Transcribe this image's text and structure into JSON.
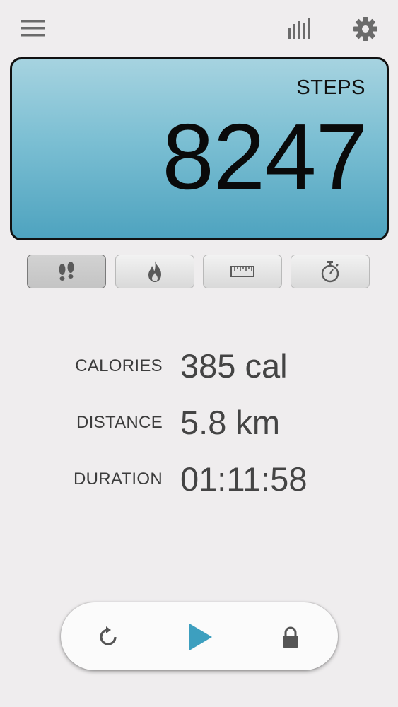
{
  "toolbar": {
    "menu_icon": "hamburger-menu-icon",
    "stats_icon": "bar-chart-icon",
    "settings_icon": "gear-icon"
  },
  "display": {
    "label": "STEPS",
    "value": "8247"
  },
  "modes": [
    {
      "name": "steps",
      "icon": "footprints-icon",
      "active": true
    },
    {
      "name": "calories",
      "icon": "flame-icon",
      "active": false
    },
    {
      "name": "distance",
      "icon": "ruler-icon",
      "active": false
    },
    {
      "name": "duration",
      "icon": "stopwatch-icon",
      "active": false
    }
  ],
  "stats": {
    "calories": {
      "label": "CALORIES",
      "value": "385 cal"
    },
    "distance": {
      "label": "DISTANCE",
      "value": "5.8 km"
    },
    "duration": {
      "label": "DURATION",
      "value": "01:11:58"
    }
  },
  "controls": {
    "reset_icon": "reset-icon",
    "play_icon": "play-icon",
    "lock_icon": "lock-icon"
  },
  "colors": {
    "display_gradient_top": "#a6d3e0",
    "display_gradient_bottom": "#4ea3bf",
    "play_accent": "#3d9fbf",
    "background": "#efedee"
  }
}
